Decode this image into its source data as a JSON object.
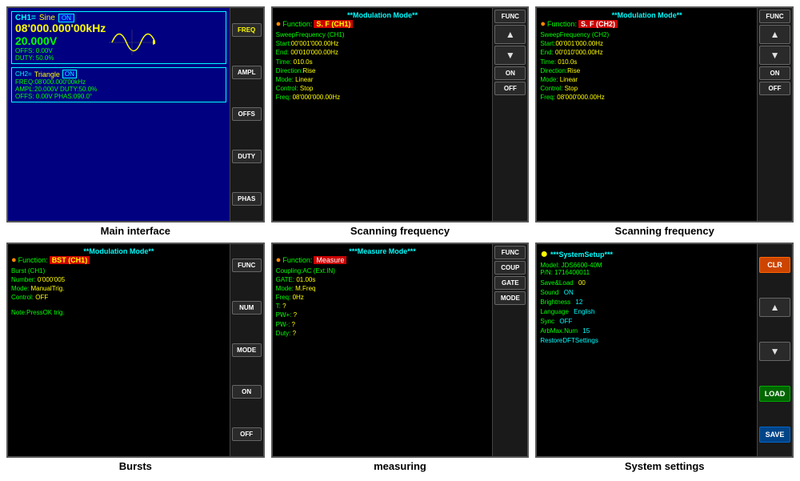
{
  "panels": {
    "row1": [
      {
        "id": "main-interface",
        "caption": "Main interface",
        "buttons": [
          "FREQ",
          "AMPL",
          "OFFS",
          "DUTY",
          "PHAS"
        ],
        "ch1": {
          "label": "CH1=",
          "waveform": "Sine",
          "on": "ON",
          "freq": "08'000.000'00kHz",
          "volt": "20.000V",
          "offs": "OFFS:  0.00V",
          "duty": "DUTY: 50.0%"
        },
        "ch2": {
          "label": "CH2=",
          "waveform": "Triangle",
          "on": "ON",
          "line1": "FREQ:08'000.000'00kHz",
          "line2": "AMPL:20.000V DUTY:50.0%",
          "line3": "OFFS:  0.00V PHAS:090.0°"
        }
      },
      {
        "id": "scanning-freq-1",
        "caption": "Scanning frequency",
        "buttons": [
          "FUNC",
          "▲",
          "▼",
          "ON",
          "OFF"
        ],
        "title": "**Modulation Mode**",
        "dot": "●",
        "func_label": "Function:",
        "func_val": "S. F (CH1)",
        "func_sub": "SweepFrequency (CH1)",
        "params": [
          {
            "key": "Start:",
            "val": "00'001'000.00Hz"
          },
          {
            "key": "End:",
            "val": "  00'010'000.00Hz"
          },
          {
            "key": "Time:",
            "val": "      010.0s"
          },
          {
            "key": "Direction:",
            "val": "Rise"
          },
          {
            "key": "Mode:",
            "val": "     Linear"
          },
          {
            "key": "Control:",
            "val": "    Stop"
          },
          {
            "key": "Freq:",
            "val": " 08'000'000.00Hz"
          }
        ]
      },
      {
        "id": "scanning-freq-2",
        "caption": "Scanning frequency",
        "buttons": [
          "FUNC",
          "▲",
          "▼",
          "ON",
          "OFF"
        ],
        "title": "**Modulation Mode**",
        "dot": "●",
        "func_label": "Function:",
        "func_val": "S. F (CH2)",
        "func_sub": "SweepFrequency (CH2)",
        "params": [
          {
            "key": "Start:",
            "val": "00'001'000.00Hz"
          },
          {
            "key": "End:",
            "val": "  00'010'000.00Hz"
          },
          {
            "key": "Time:",
            "val": "      010.0s"
          },
          {
            "key": "Direction:",
            "val": "Rise"
          },
          {
            "key": "Mode:",
            "val": "     Linear"
          },
          {
            "key": "Control:",
            "val": "    Stop"
          },
          {
            "key": "Freq:",
            "val": " 08'000'000.00Hz"
          }
        ]
      }
    ],
    "row2": [
      {
        "id": "bursts",
        "caption": "Bursts",
        "buttons": [
          "FUNC",
          "NUM",
          "MODE",
          "ON",
          "OFF"
        ],
        "title": "**Modulation Mode**",
        "dot": "●",
        "func_label": "Function:",
        "func_val": "BST (CH1)",
        "func_sub": "Burst (CH1)",
        "params": [
          {
            "key": "Number:",
            "val": "  0'000'005"
          },
          {
            "key": "Mode:",
            "val": "    ManualTrig."
          },
          {
            "key": "Control:",
            "val": "  OFF"
          },
          {
            "key": "",
            "val": ""
          },
          {
            "key": "Note:PressOK trig.",
            "val": ""
          }
        ]
      },
      {
        "id": "measuring",
        "caption": "measuring",
        "buttons": [
          "FUNC",
          "COUP",
          "GATE",
          "MODE"
        ],
        "title": "***Measure Mode***",
        "dot": "●",
        "func_label": "Function:",
        "func_val": "Measure",
        "func_sub": "Coupling:AC (Ext.IN)",
        "params": [
          {
            "key": "GATE:",
            "val": "    01.00s"
          },
          {
            "key": "Mode:",
            "val": "    M.Freq"
          },
          {
            "key": "Freq:",
            "val": "       0Hz"
          },
          {
            "key": "T:",
            "val": "          ?"
          },
          {
            "key": "PW+:",
            "val": "         ?"
          },
          {
            "key": "PW-:",
            "val": "         ?"
          },
          {
            "key": "Duty:",
            "val": "        ?"
          }
        ]
      },
      {
        "id": "system-settings",
        "caption": "System settings",
        "buttons": [
          "CLR",
          "▲",
          "▼",
          "LOAD",
          "SAVE"
        ],
        "title": "***SystemSetup***",
        "model": "Model:    JDS6600-40M",
        "pn": "P/N:      1716400011",
        "dot": "●",
        "params": [
          {
            "key": "Save&Load",
            "val": "00",
            "color": "yellow"
          },
          {
            "key": "Sound",
            "val": "ON",
            "color": "cyan"
          },
          {
            "key": "Brightness",
            "val": "12",
            "color": "cyan"
          },
          {
            "key": "Language",
            "val": "English",
            "color": "cyan"
          },
          {
            "key": "Sync",
            "val": "OFF",
            "color": "cyan"
          },
          {
            "key": "ArbMax.Num",
            "val": "15",
            "color": "cyan"
          },
          {
            "key": "RestoreDFTSettings",
            "val": "",
            "color": "cyan"
          }
        ]
      }
    ]
  }
}
